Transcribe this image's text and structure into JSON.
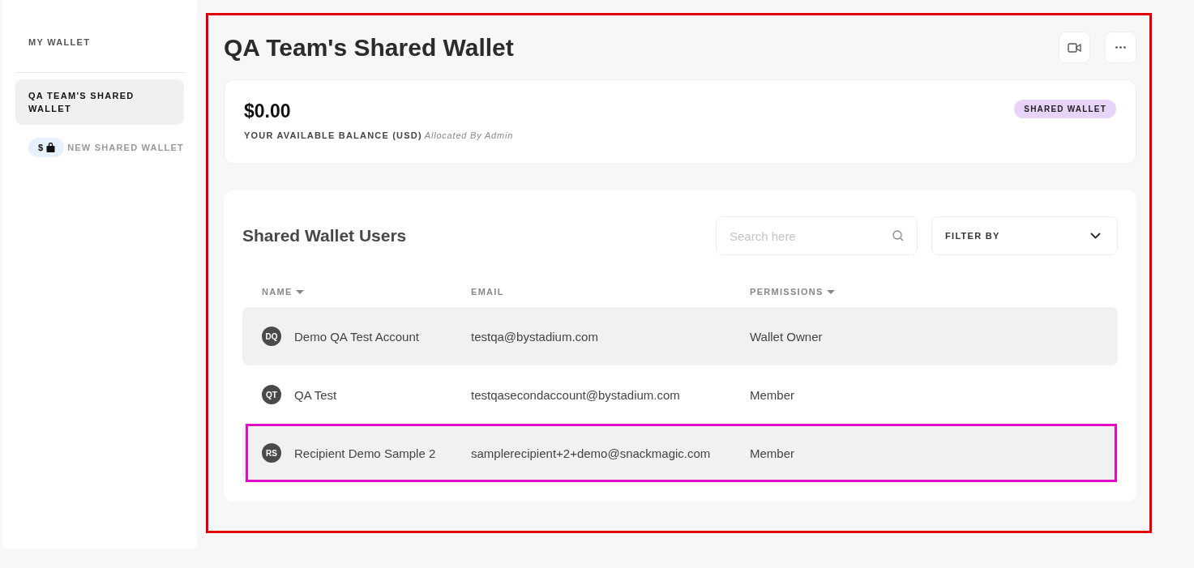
{
  "sidebar": {
    "items": [
      {
        "label": "MY WALLET",
        "selected": false
      },
      {
        "label": "QA TEAM'S SHARED WALLET",
        "selected": true
      }
    ],
    "new_wallet": {
      "symbol": "$",
      "label": "NEW SHARED WALLET"
    }
  },
  "annotations": [
    {
      "kind": "panel",
      "color": "#e00000"
    },
    {
      "kind": "row",
      "color": "#e10cc4"
    }
  ],
  "main": {
    "title": "QA Team's Shared Wallet",
    "balance": {
      "amount": "$0.00",
      "label": "YOUR AVAILABLE BALANCE (USD)",
      "note": "Allocated By Admin",
      "badge": "SHARED WALLET"
    },
    "users": {
      "title": "Shared Wallet Users",
      "search": {
        "placeholder": "Search here"
      },
      "filter": {
        "label": "FILTER BY"
      },
      "columns": [
        {
          "label": "NAME",
          "sortable": true
        },
        {
          "label": "EMAIL",
          "sortable": false
        },
        {
          "label": "PERMISSIONS",
          "sortable": true
        }
      ],
      "rows": [
        {
          "initials": "DQ",
          "name": "Demo QA Test Account",
          "email": "testqa@bystadium.com",
          "permission": "Wallet Owner",
          "highlighted": true,
          "framed": false
        },
        {
          "initials": "QT",
          "name": "QA Test",
          "email": "testqasecondaccount@bystadium.com",
          "permission": "Member",
          "highlighted": false,
          "framed": false
        },
        {
          "initials": "RS",
          "name": "Recipient Demo Sample 2",
          "email": "samplerecipient+2+demo@snackmagic.com",
          "permission": "Member",
          "highlighted": true,
          "framed": true
        }
      ]
    }
  }
}
